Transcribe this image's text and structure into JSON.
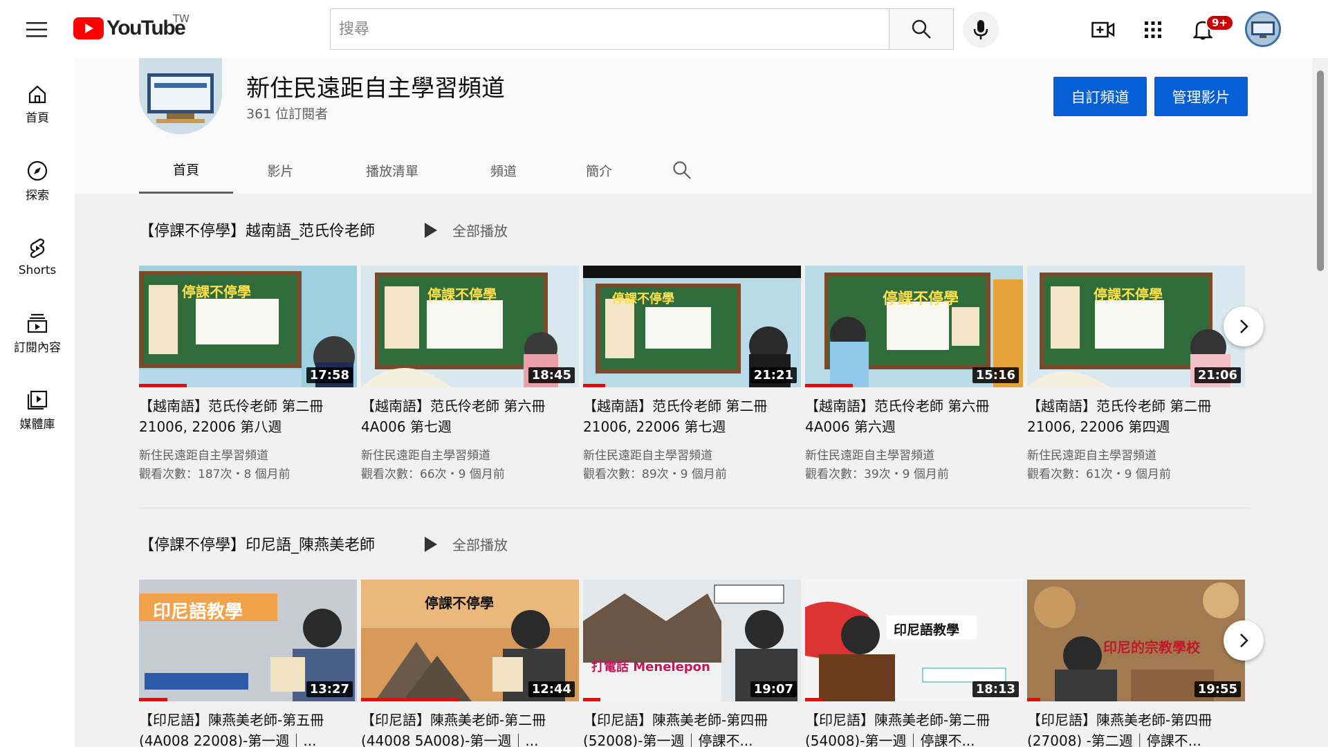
{
  "topbar": {
    "logo_text": "YouTube",
    "region": "TW",
    "search_placeholder": "搜尋",
    "notification_count": "9+"
  },
  "sidebar": {
    "items": [
      {
        "label": "首頁",
        "icon": "home-icon"
      },
      {
        "label": "探索",
        "icon": "compass-icon"
      },
      {
        "label": "Shorts",
        "icon": "shorts-icon"
      },
      {
        "label": "訂閱內容",
        "icon": "subscriptions-icon"
      },
      {
        "label": "媒體庫",
        "icon": "library-icon"
      }
    ]
  },
  "channel": {
    "name": "新住民遠距自主學習頻道",
    "subscribers": "361 位訂閱者",
    "customize_label": "自訂頻道",
    "manage_label": "管理影片",
    "tabs": [
      "首頁",
      "影片",
      "播放清單",
      "頻道",
      "簡介"
    ],
    "active_tab": "首頁"
  },
  "shelves": [
    {
      "title": "【停課不停學】越南語_范氏伶老師",
      "play_all": "全部播放",
      "videos": [
        {
          "title": "【越南語】范氏伶老師 第二冊 21006, 22006 第八週",
          "channel": "新住民遠距自主學習頻道",
          "meta": "觀看次數：187次・8 個月前",
          "duration": "17:58",
          "thumb_text": "停課不停學",
          "progress": 0.22
        },
        {
          "title": "【越南語】范氏伶老師 第六冊 4A006 第七週",
          "channel": "新住民遠距自主學習頻道",
          "meta": "觀看次數：66次・9 個月前",
          "duration": "18:45",
          "thumb_text": "停課不停學",
          "progress": 0
        },
        {
          "title": "【越南語】范氏伶老師 第二冊 21006, 22006 第七週",
          "channel": "新住民遠距自主學習頻道",
          "meta": "觀看次數：89次・9 個月前",
          "duration": "21:21",
          "thumb_text": "停課不停學",
          "progress": 0.1
        },
        {
          "title": "【越南語】范氏伶老師 第六冊 4A006 第六週",
          "channel": "新住民遠距自主學習頻道",
          "meta": "觀看次數：39次・9 個月前",
          "duration": "15:16",
          "thumb_text": "停課不停學",
          "progress": 0.22
        },
        {
          "title": "【越南語】范氏伶老師 第二冊 21006, 22006 第四週",
          "channel": "新住民遠距自主學習頻道",
          "meta": "觀看次數：61次・9 個月前",
          "duration": "21:06",
          "thumb_text": "停課不停學",
          "progress": 0
        }
      ]
    },
    {
      "title": "【停課不停學】印尼語_陳燕美老師",
      "play_all": "全部播放",
      "videos": [
        {
          "title": "【印尼語】陳燕美老師-第五冊(4A008 22008)-第一週｜...",
          "duration": "13:27",
          "thumb_text": "印尼語教學",
          "progress": 0.13
        },
        {
          "title": "【印尼語】陳燕美老師-第二冊(44008 5A008)-第一週｜...",
          "duration": "12:44",
          "thumb_text": "停課不停學",
          "progress": 0.45
        },
        {
          "title": "【印尼語】陳燕美老師-第四冊(52008)-第一週｜停課不...",
          "duration": "19:07",
          "thumb_text": "打電話 Menelepon",
          "progress": 0.08
        },
        {
          "title": "【印尼語】陳燕美老師-第二冊(54008)-第一週｜停課不...",
          "duration": "18:13",
          "thumb_text": "印尼語教學",
          "progress": 0.08
        },
        {
          "title": "【印尼語】陳燕美老師-第四冊(27008) -第二週｜停課不...",
          "duration": "19:55",
          "thumb_text": "印尼的宗教學校",
          "progress": 0.06
        }
      ]
    }
  ],
  "colors": {
    "accent_blue": "#065fd4",
    "youtube_red": "#ff0000",
    "chalkboard_green": "#2f6b3b"
  }
}
